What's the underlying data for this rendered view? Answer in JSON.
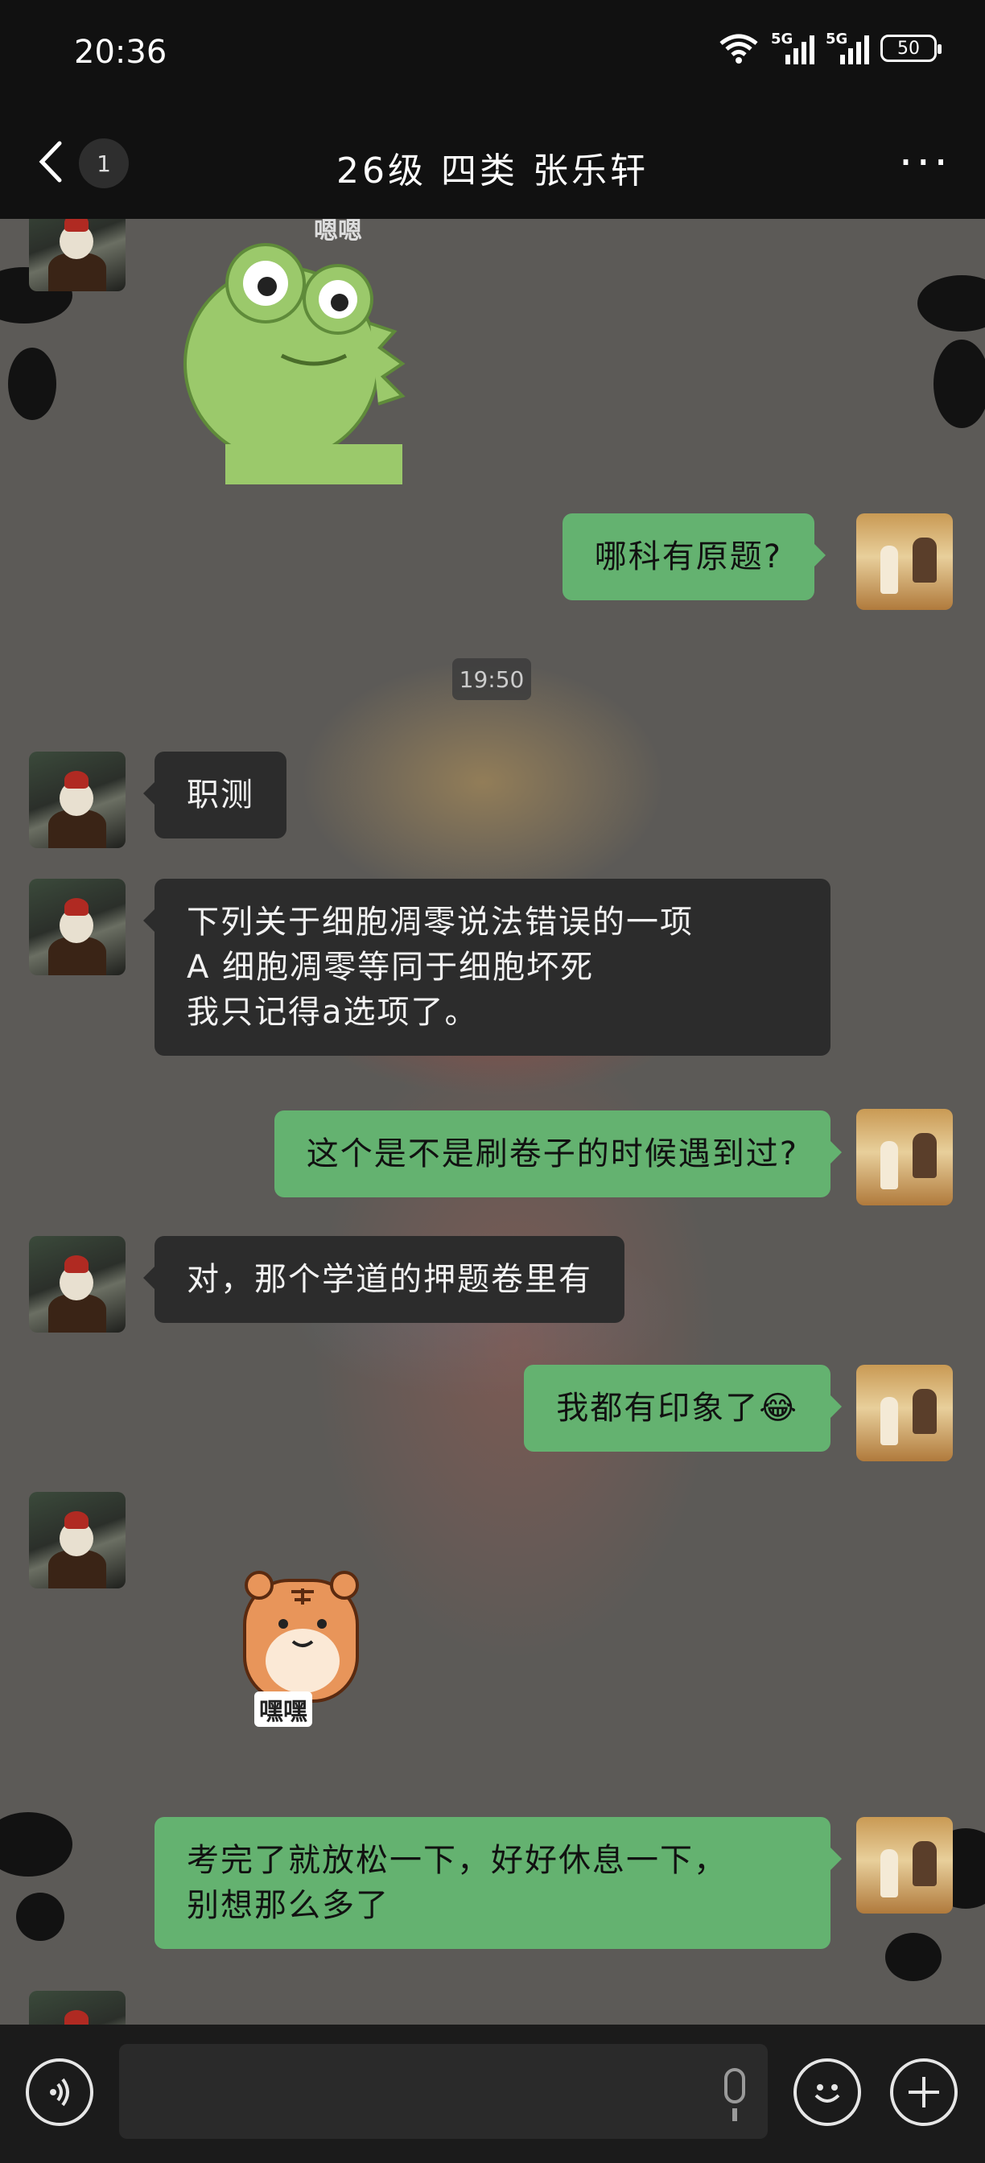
{
  "status_bar": {
    "time": "20:36",
    "network1": "5G",
    "network2": "5G",
    "battery": "50"
  },
  "nav": {
    "back_icon": "chevron-left-icon",
    "unread_badge": "1",
    "title": "26级 四类 张乐轩",
    "more_icon": "more-dots-icon"
  },
  "chat": {
    "frog_sticker_caption": "嗯嗯",
    "msg_1": "哪科有原题?",
    "timestamp": "19:50",
    "msg_2": "职测",
    "msg_3_lines": [
      "下列关于细胞凋零说法错误的一项",
      "A 细胞凋零等同于细胞坏死",
      "我只记得a选项了。"
    ],
    "msg_4": "这个是不是刷卷子的时候遇到过?",
    "msg_5": "对，那个学道的押题卷里有",
    "msg_6": "我都有印象了😂",
    "tiger_sticker_caption": "嘿嘿",
    "msg_7_lines": [
      "考完了就放松一下，好好休息一下，",
      "别想那么多了"
    ]
  },
  "input_bar": {
    "voice_icon": "voice-icon",
    "mic_icon": "mic-icon",
    "emoji_icon": "emoji-icon",
    "plus_icon": "plus-icon"
  },
  "colors": {
    "sent_bubble": "#64b270",
    "received_bubble": "#2c2c2c",
    "bar_bg": "#111111"
  }
}
